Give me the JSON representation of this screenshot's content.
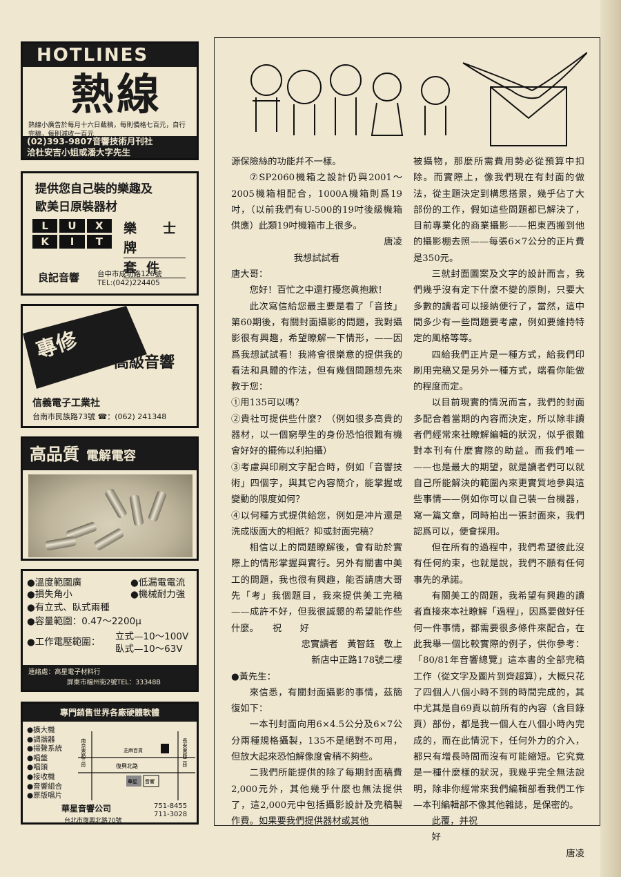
{
  "ads": {
    "hotlines": {
      "en_title": "HOTLINES",
      "zh_title": "熱線",
      "note": "熱線小廣告於每月十六日截稿，每則價格七百元，自行完稿，每則減收一百元",
      "phone_line": "(02)393-9807音響技術月刊社",
      "contact_line": "洽杜安吉小姐或潘大字先生"
    },
    "lux": {
      "headline1": "提供您自己裝的樂趣及",
      "headline2": "歐美日原裝器材",
      "logo_row1": [
        "L",
        "U",
        "X"
      ],
      "logo_row2": [
        "K",
        "I",
        "T"
      ],
      "brand1": "樂士牌",
      "brand2": "套件",
      "shop": "良記音響",
      "address": "台中市成功路126號",
      "tel": "TEL:(042)224405"
    },
    "repair": {
      "badge": "專修",
      "service": "高級音響",
      "company": "信義電子工業社",
      "address": "台南市民族路73號 ☎：(062) 241348"
    },
    "capacitor": {
      "headline": "高品質",
      "subhead": "電解電容"
    },
    "features": {
      "items_left": [
        "●溫度範圍廣",
        "●損失角小",
        "●有立式、臥式兩種",
        "●容量範圍：0.47～2200μ",
        "●工作電壓範圍："
      ],
      "items_right": [
        "●低漏電電流",
        "●機械耐力強"
      ],
      "voltage_upright": "立式—10～100V",
      "voltage_lying": "臥式—10～63V",
      "contact_label": "連絡處：高星電子材料行",
      "contact_address": "屏東市楊州街2號TEL：33348B"
    },
    "huaxing": {
      "header": "專門銷售世界各廠硬體軟體",
      "products": [
        "●擴大機",
        "●調諧器",
        "●揚聲系統",
        "●唱盤",
        "●唱頭",
        "●接收機",
        "●音響組合",
        "●原版唱片"
      ],
      "map_labels": [
        "南京東路三段",
        "芝麻百貨",
        "長安東路二段",
        "復興北路",
        "華星",
        "音響"
      ],
      "company": "華星音響公司",
      "tel1": "751-8455",
      "tel2": "711-3028",
      "address": "台北市復興北路70號"
    }
  },
  "article": {
    "col1": [
      {
        "cls": "",
        "text": "源保險絲的功能幷不一樣。"
      },
      {
        "cls": "ind",
        "text": "⑦SP2060機箱之設計仍與2001～2005機箱相配合，1000A機箱則爲19吋，（以前我們有U-500的19吋後級機箱供應）此類19吋機箱市上很多。"
      },
      {
        "cls": "right",
        "text": "唐凌"
      },
      {
        "cls": "center",
        "text": "我想試試看"
      },
      {
        "cls": "",
        "text": "唐大哥："
      },
      {
        "cls": "ind",
        "text": "您好！百忙之中還打擾您眞抱歉！"
      },
      {
        "cls": "ind",
        "text": "此次寫信給您最主要是看了「音技」第60期後，有關封面攝影的問題，我對攝影很有興趣，希望瞭解一下情形，——因爲我想試試看！我將會很樂意的提供我的看法和具體的作法，但有幾個問題想先來教于您："
      },
      {
        "cls": "",
        "text": "①用135可以嗎？"
      },
      {
        "cls": "",
        "text": "②貴社可提供些什麼？（例如很多高貴的器材，以一個窮學生的身份恐怕很難有機會好好的擺佈以利拍攝）"
      },
      {
        "cls": "",
        "text": "③考慮與印刷文字配合時，例如「音響技術」四個字，與其它內容簡介，能掌握或變動的限度如何？"
      },
      {
        "cls": "",
        "text": "④以何種方式提供給您，例如是冲片還是洗成版面大的相紙？抑或封面完稿？"
      },
      {
        "cls": "ind",
        "text": "相信以上的問題瞭解後，會有助於實際上的情形掌握與實行。另外有關書中美工的問題，我也很有興趣，能否請唐大哥先「考」我個題目，我來提供美工完稿——成許不好，但我很誠懇的希望能作些什麼。　　祝　　好"
      },
      {
        "cls": "right",
        "text": "忠實讀者　黃智鈺　敬上"
      },
      {
        "cls": "right",
        "text": "新店中正路178號二樓"
      },
      {
        "cls": "",
        "text": "●黃先生："
      },
      {
        "cls": "ind",
        "text": "來信悉，有關封面攝影的事情，茲簡復如下："
      },
      {
        "cls": "ind",
        "text": "一本刊封面向用6×4.5公分及6×7公分兩種規格攝製，135不是絕對不可用，但放大起來恐怕解像度會稍不夠些。"
      },
      {
        "cls": "ind",
        "text": "二我們所能提供的除了每期封面稿費2,000元外，其他幾乎什麼也無法提供了，這2,000元中包括攝影設計及完稿製作費。如果要我們提供器材或其他"
      }
    ],
    "col2": [
      {
        "cls": "",
        "text": "被攝物，那麼所需費用勢必從預算中扣除。而實際上，像我們現在有封面的做法，從主題決定到構思搭景，幾乎佔了大部份的工作，假如這些問題都已解決了，目前專業化的商業攝影——把東西搬到他的攝影棚去照——每張6×7公分的正片費是350元。"
      },
      {
        "cls": "ind",
        "text": "三就封面圖案及文字的設計而言，我們幾乎沒有定下什麼不變的原則，只要大多數的讀者可以接納便行了，當然，這中間多少有一些問題要考慮，例如要維持特定的風格等等。"
      },
      {
        "cls": "ind",
        "text": "四給我們正片是一種方式，給我們印刷用完稿又是另外一種方式，端看你能做的程度而定。"
      },
      {
        "cls": "ind",
        "text": "以目前現實的情況而言，我們的封面多配合着當期的內容而決定，所以除非讀者們經常來社瞭解編輯的狀況，似乎很難對本刊有什麼實際的助益。而我們唯一——也是最大的期望，就是讀者們可以就自己所能解決的範圍內來更實質地參與這些事情——例如你可以自己裝一台機器，寫一篇文章，同時拍出一張封面來，我們認爲可以，便會採用。"
      },
      {
        "cls": "ind",
        "text": "但在所有的過程中，我們希望彼此沒有任何約束，也就是說，我們不願有任何事先的承諾。"
      },
      {
        "cls": "ind",
        "text": "有關美工的問題，我希望有興趣的讀者直接來本社瞭解「過程」，因爲要做好任何一件事情，都需要很多條件來配合，在此我舉一個比較實際的例子，供你參考：「80/81年音響總覽」這本書的全部完稿工作（從文字及圖片到齊超算），大概只花了四個人八個小時不到的時間完成的，其中尤其是自69頁以前所有的內容（含目錄頁）部份，都是我一個人在八個小時內完成的，而在此情況下，任何外力的介入，都只有增長時間而沒有可能縮短。它究竟是一種什麼樣的狀況，我幾乎完全無法說明，除非你經常來我們編輯部看我們工作—本刊編輯部不像其他雜誌，是保密的。"
      },
      {
        "cls": "ind",
        "text": "此覆，并祝"
      },
      {
        "cls": "ind",
        "text": "好"
      },
      {
        "cls": "right",
        "text": "唐凌"
      }
    ]
  }
}
